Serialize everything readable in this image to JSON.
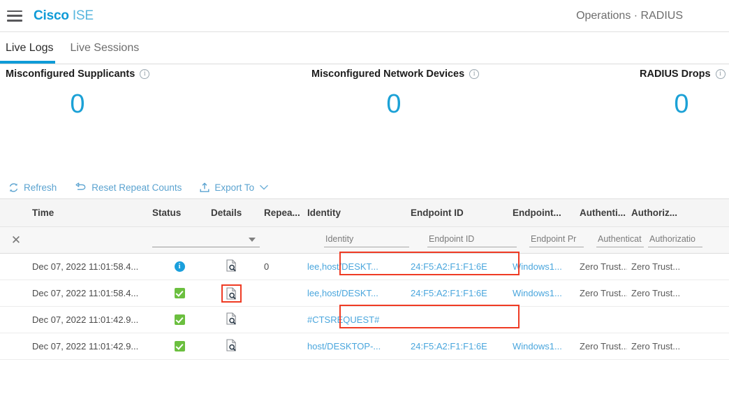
{
  "topbar": {
    "menu_icon": "hamburger-menu-icon",
    "brand_bold": "Cisco",
    "brand_light": "ISE",
    "breadcrumb": "Operations · RADIUS"
  },
  "tabs": [
    {
      "label": "Live Logs",
      "active": true
    },
    {
      "label": "Live Sessions",
      "active": false
    }
  ],
  "metrics": [
    {
      "title": "Misconfigured Supplicants",
      "value": "0",
      "info_icon": "info-icon"
    },
    {
      "title": "Misconfigured Network Devices",
      "value": "0",
      "info_icon": "info-icon"
    },
    {
      "title": "RADIUS Drops",
      "value": "0",
      "info_icon": "info-icon"
    }
  ],
  "toolbar": {
    "refresh_label": "Refresh",
    "reset_label": "Reset Repeat Counts",
    "export_label": "Export To",
    "refresh_icon": "refresh-icon",
    "reset_icon": "undo-arrow-icon",
    "export_icon": "upload-icon",
    "export_chevron": "chevron-down-icon"
  },
  "table": {
    "columns": [
      "Time",
      "Status",
      "Details",
      "Repea...",
      "Identity",
      "Endpoint ID",
      "Endpoint...",
      "Authenti...",
      "Authoriz..."
    ],
    "filters": {
      "clear_icon": "close-x-icon",
      "status_select_value": "",
      "identity_placeholder": "Identity",
      "endpoint_id_placeholder": "Endpoint ID",
      "endpoint_profile_placeholder": "Endpoint Pr",
      "authentication_placeholder": "Authenticat",
      "authorization_placeholder": "Authorizatio"
    },
    "rows": [
      {
        "time": "Dec 07, 2022 11:01:58.4...",
        "status": "info",
        "details_icon": "details-magnifier-icon",
        "repeat": "0",
        "identity": "lee,host/DESKT...",
        "endpoint_id": "24:F5:A2:F1:F1:6E",
        "endpoint_profile": "Windows1...",
        "authentication": "Zero Trust...",
        "authorization": "Zero Trust..."
      },
      {
        "time": "Dec 07, 2022 11:01:58.4...",
        "status": "ok",
        "details_icon": "details-magnifier-icon",
        "repeat": "",
        "identity": "lee,host/DESKT...",
        "endpoint_id": "24:F5:A2:F1:F1:6E",
        "endpoint_profile": "Windows1...",
        "authentication": "Zero Trust...",
        "authorization": "Zero Trust..."
      },
      {
        "time": "Dec 07, 2022 11:01:42.9...",
        "status": "ok",
        "details_icon": "details-magnifier-icon",
        "repeat": "",
        "identity": "#CTSREQUEST#",
        "endpoint_id": "",
        "endpoint_profile": "",
        "authentication": "",
        "authorization": ""
      },
      {
        "time": "Dec 07, 2022 11:01:42.9...",
        "status": "ok",
        "details_icon": "details-magnifier-icon",
        "repeat": "",
        "identity": "host/DESKTOP-...",
        "endpoint_id": "24:F5:A2:F1:F1:6E",
        "endpoint_profile": "Windows1...",
        "authentication": "Zero Trust...",
        "authorization": "Zero Trust..."
      }
    ]
  },
  "colors": {
    "brand_blue": "#0f9bd7",
    "link_blue": "#4aa6dd",
    "metric_blue": "#1ba1d6",
    "status_ok_green": "#6bbf3f",
    "status_info_blue": "#1a9fdc",
    "highlight_red": "#ef3b24"
  }
}
